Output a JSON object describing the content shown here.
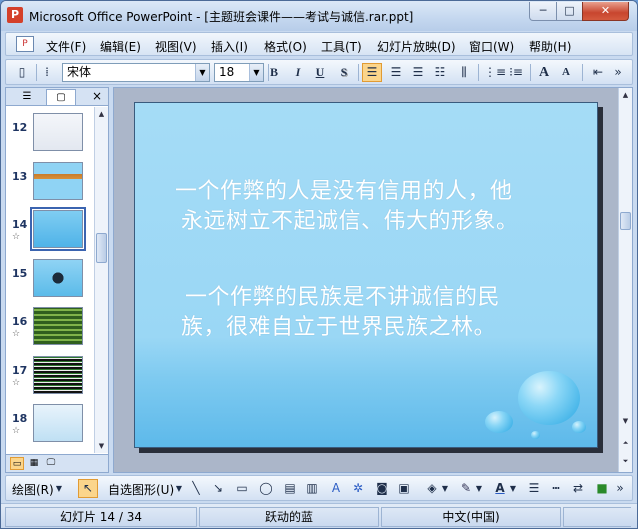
{
  "window": {
    "title": "Microsoft Office PowerPoint - [主题班会课件——考试与诚信.rar.ppt]",
    "app_icon": "powerpoint-icon",
    "controls": {
      "minimize": "─",
      "maximize": "□",
      "close": "✕"
    }
  },
  "menu": {
    "items": [
      "文件(F)",
      "编辑(E)",
      "视图(V)",
      "插入(I)",
      "格式(O)",
      "工具(T)",
      "幻灯片放映(D)",
      "窗口(W)",
      "帮助(H)"
    ]
  },
  "format_toolbar": {
    "font_name": "宋体",
    "font_size": "18",
    "bold": "B",
    "italic": "I",
    "underline": "U",
    "shadow": "S",
    "increase_font": "A",
    "decrease_font": "A",
    "font_color": "A"
  },
  "slides_pane": {
    "tab_outline_icon": "outline-icon",
    "tab_slides_icon": "slides-icon",
    "close": "×",
    "thumbnails": [
      {
        "number": "12",
        "has_animation": false,
        "style": "plain"
      },
      {
        "number": "13",
        "has_animation": false,
        "style": "banner"
      },
      {
        "number": "14",
        "has_animation": true,
        "style": "selected",
        "selected": true
      },
      {
        "number": "15",
        "has_animation": false,
        "style": "dots"
      },
      {
        "number": "16",
        "has_animation": true,
        "style": "green"
      },
      {
        "number": "17",
        "has_animation": true,
        "style": "dark"
      },
      {
        "number": "18",
        "has_animation": true,
        "style": "light"
      }
    ],
    "animation_mark": "☆"
  },
  "slide": {
    "paragraph1_line1": "一个作弊的人是没有信用的人，他",
    "paragraph1_line2": "永远树立不起诚信、伟大的形象。",
    "paragraph2_line1": "一个作弊的民族是不讲诚信的民",
    "paragraph2_line2": "族，很难自立于世界民族之林。"
  },
  "draw_toolbar": {
    "draw_label": "绘图(R)",
    "autoshapes_label": "自选图形(U)"
  },
  "status": {
    "slide_position": "幻灯片 14 / 34",
    "design_name": "跃动的蓝",
    "language": "中文(中国)"
  },
  "colors": {
    "slide_background": "#9ad7f5",
    "slide_text": "#ffffff",
    "active_button": "#fbd58b",
    "chrome": "#c9daf0"
  }
}
